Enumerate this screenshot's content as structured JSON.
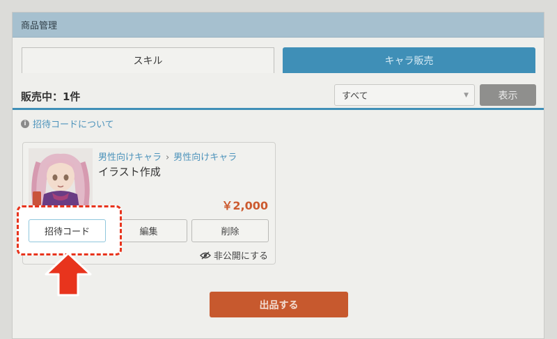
{
  "header": {
    "title": "商品管理"
  },
  "tabs": [
    {
      "label": "スキル"
    },
    {
      "label": "キャラ販売"
    }
  ],
  "listing": {
    "count_text": "販売中：1件",
    "filter": {
      "selected": "すべて"
    },
    "show_label": "表示",
    "invite_link": "招待コードについて"
  },
  "item": {
    "breadcrumb": [
      "男性向けキャラ",
      "男性向けキャラ"
    ],
    "title": "イラスト作成",
    "price": "￥2,000",
    "buttons": {
      "invite": "招待コード",
      "edit": "編集",
      "delete": "削除"
    },
    "unpublish_label": "非公開にする"
  },
  "publish_label": "出品する",
  "colors": {
    "accent": "#3f8fb7",
    "publish": "#c7592e",
    "price": "#cc5a2f",
    "highlight": "#e8341d"
  },
  "icons": {
    "info": "info-icon",
    "eye": "eye-slash-icon",
    "arrow": "up-arrow-icon",
    "chevron": "chevron-down-icon"
  }
}
